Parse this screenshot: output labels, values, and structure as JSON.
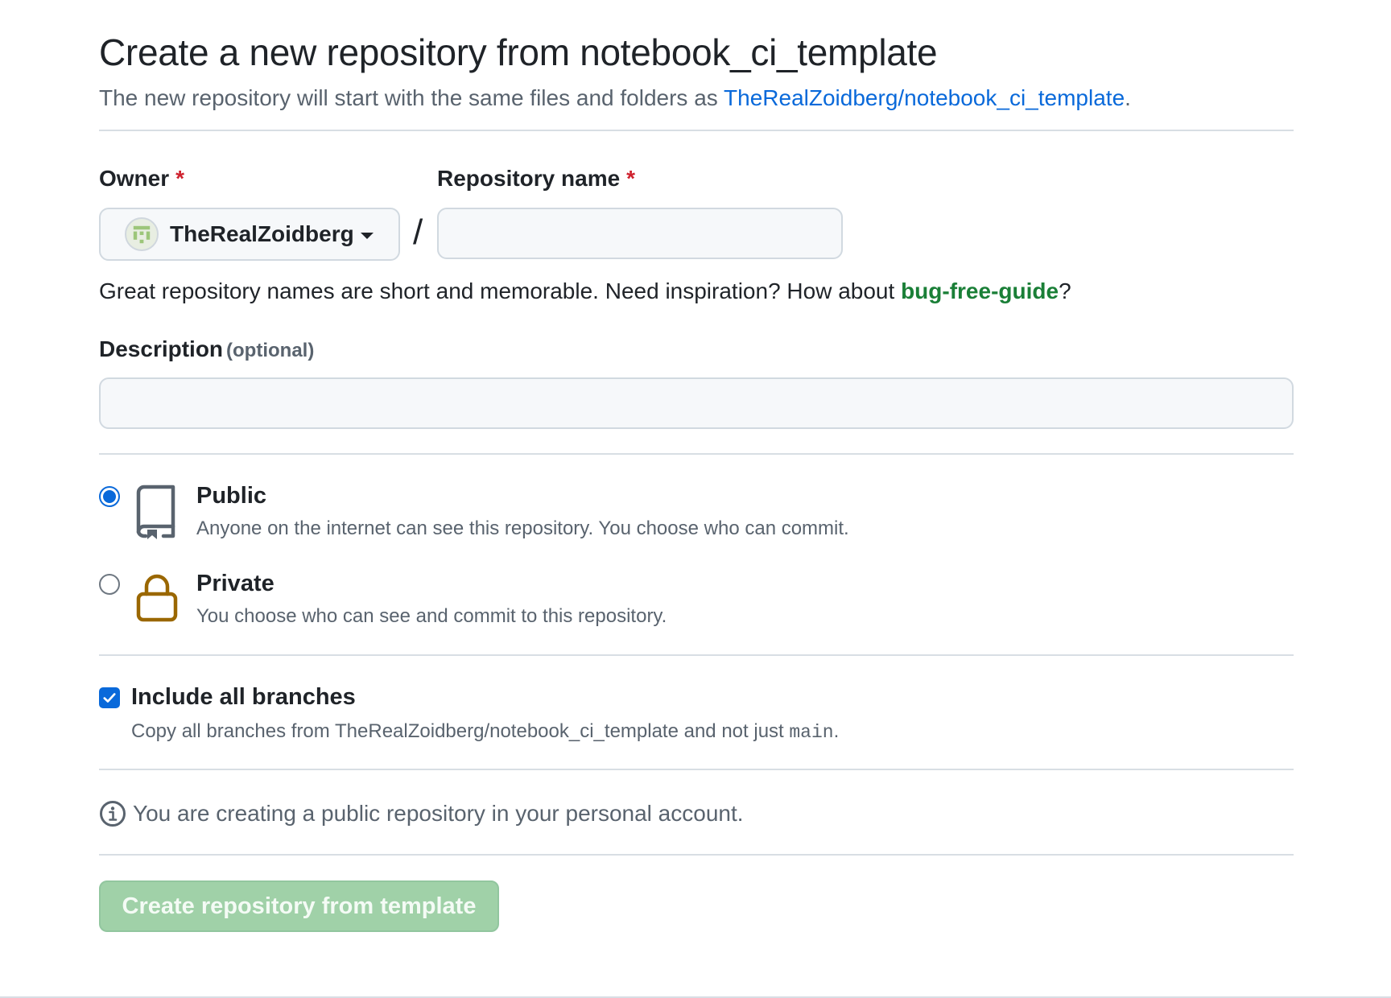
{
  "header": {
    "title": "Create a new repository from notebook_ci_template",
    "subtitle_prefix": "The new repository will start with the same files and folders as ",
    "template_link": "TheRealZoidberg/notebook_ci_template",
    "subtitle_suffix": "."
  },
  "owner": {
    "label": "Owner",
    "required_marker": "*",
    "selected": "TheRealZoidberg",
    "avatar_icon": "identicon-avatar"
  },
  "repo_name": {
    "label": "Repository name",
    "required_marker": "*",
    "value": "",
    "separator": "/"
  },
  "name_hint": {
    "text": "Great repository names are short and memorable. Need inspiration? How about ",
    "suggestion": "bug-free-guide",
    "suffix": "?"
  },
  "description": {
    "label": "Description",
    "optional": "(optional)",
    "value": ""
  },
  "visibility": {
    "selected": "public",
    "options": [
      {
        "id": "public",
        "title": "Public",
        "description": "Anyone on the internet can see this repository. You choose who can commit.",
        "icon": "repo-book-icon"
      },
      {
        "id": "private",
        "title": "Private",
        "description": "You choose who can see and commit to this repository.",
        "icon": "lock-icon"
      }
    ]
  },
  "branches": {
    "checked": true,
    "label": "Include all branches",
    "description_prefix": "Copy all branches from TheRealZoidberg/notebook_ci_template and not just ",
    "branch_code": "main",
    "description_suffix": "."
  },
  "info": {
    "icon": "info-icon",
    "text": "You are creating a public repository in your personal account."
  },
  "submit": {
    "label": "Create repository from template",
    "disabled": true
  },
  "colors": {
    "accent_blue": "#0969da",
    "success_green": "#1a7f37",
    "required_red": "#cf222e",
    "lock_brown": "#9a6700",
    "button_disabled_green": "#a0d1a8"
  }
}
